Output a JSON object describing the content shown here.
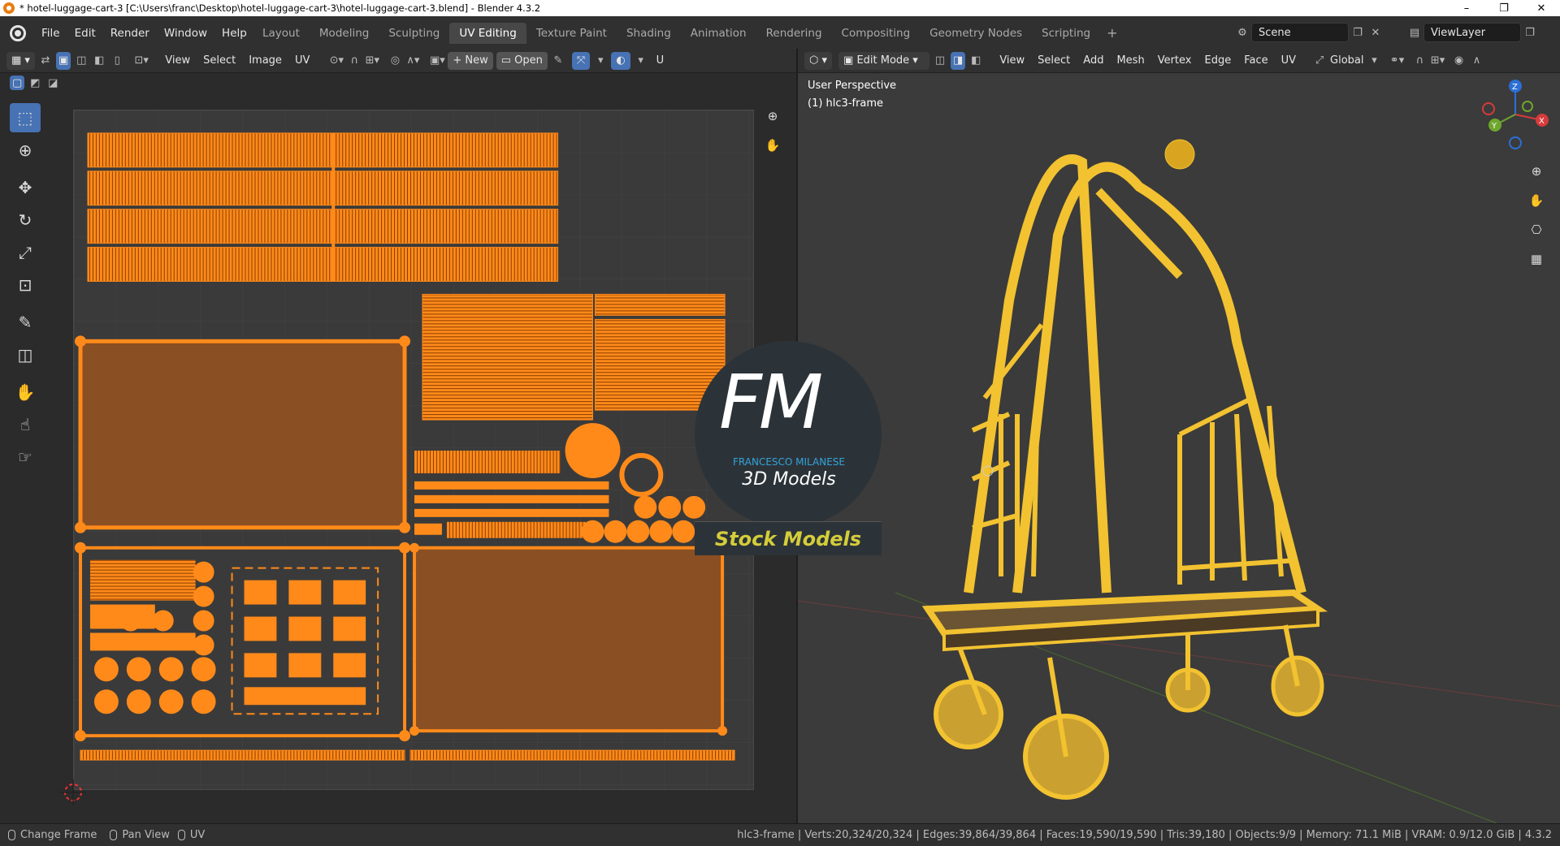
{
  "window": {
    "title": "* hotel-luggage-cart-3 [C:\\Users\\franc\\Desktop\\hotel-luggage-cart-3\\hotel-luggage-cart-3.blend] - Blender 4.3.2",
    "min": "–",
    "max": "❐",
    "close": "✕"
  },
  "menu": [
    "File",
    "Edit",
    "Render",
    "Window",
    "Help"
  ],
  "workspaces": [
    {
      "label": "Layout",
      "active": false
    },
    {
      "label": "Modeling",
      "active": false
    },
    {
      "label": "Sculpting",
      "active": false
    },
    {
      "label": "UV Editing",
      "active": true
    },
    {
      "label": "Texture Paint",
      "active": false
    },
    {
      "label": "Shading",
      "active": false
    },
    {
      "label": "Animation",
      "active": false
    },
    {
      "label": "Rendering",
      "active": false
    },
    {
      "label": "Compositing",
      "active": false
    },
    {
      "label": "Geometry Nodes",
      "active": false
    },
    {
      "label": "Scripting",
      "active": false
    }
  ],
  "workspace_add": "+",
  "scene": {
    "label": "Scene",
    "view_layer": "ViewLayer"
  },
  "uv_header": {
    "menus": [
      "View",
      "Select",
      "Image",
      "UV"
    ],
    "new": "New",
    "open": "Open",
    "uv_trunc": "U"
  },
  "view3d_header": {
    "mode": "Edit Mode",
    "menus": [
      "View",
      "Select",
      "Add",
      "Mesh",
      "Vertex",
      "Edge",
      "Face",
      "UV"
    ],
    "orientation": "Global"
  },
  "viewport": {
    "perspective": "User Perspective",
    "object": "(1) hlc3-frame"
  },
  "gizmo": {
    "z": "Z",
    "y": "Y",
    "x": "X"
  },
  "watermark": {
    "letters": "FM",
    "name": "FRANCESCO MILANESE",
    "sub": "3D Models",
    "banner": "Stock Models"
  },
  "status": {
    "hints": [
      "Change Frame",
      "Pan View",
      "UV"
    ],
    "info": "hlc3-frame | Verts:20,324/20,324 | Edges:39,864/39,864 | Faces:19,590/19,590 | Tris:39,180 | Objects:9/9 | Memory: 71.1 MiB | VRAM: 0.9/12.0 GiB | 4.3.2"
  },
  "colors": {
    "accent": "#4772b3",
    "uv_orange": "#ff8a1a",
    "mesh_yellow": "#f2c230",
    "active_tab": "#474747"
  }
}
